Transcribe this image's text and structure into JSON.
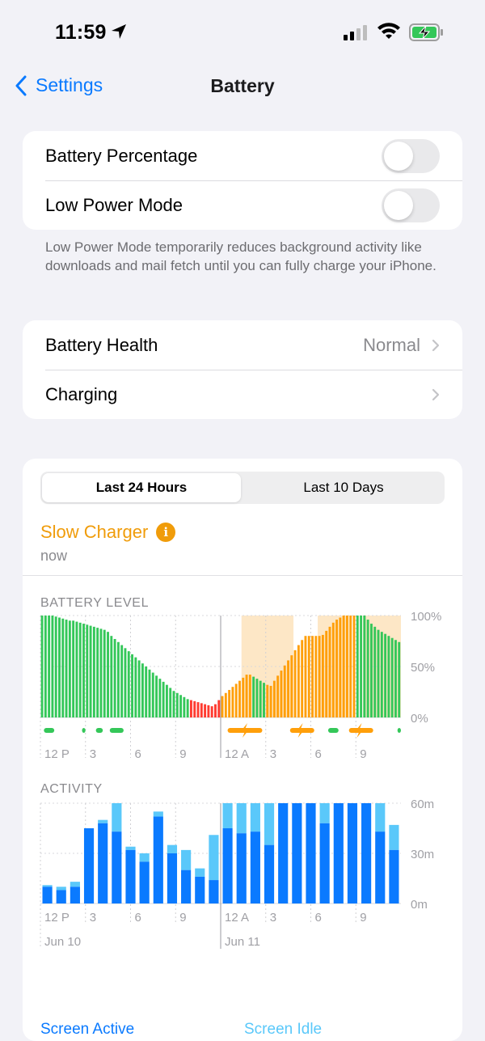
{
  "status": {
    "time": "11:59"
  },
  "nav": {
    "back_label": "Settings",
    "title": "Battery"
  },
  "settings_group1": {
    "battery_percentage": {
      "label": "Battery Percentage",
      "on": false
    },
    "low_power_mode": {
      "label": "Low Power Mode",
      "on": false
    },
    "footnote": "Low Power Mode temporarily reduces background activity like downloads and mail fetch until you can fully charge your iPhone."
  },
  "settings_group2": {
    "battery_health": {
      "label": "Battery Health",
      "value": "Normal"
    },
    "charging": {
      "label": "Charging"
    }
  },
  "usage": {
    "segments": [
      "Last 24 Hours",
      "Last 10 Days"
    ],
    "selected_segment": "Last 24 Hours",
    "charger_title": "Slow Charger",
    "charger_time": "now",
    "battery_label": "BATTERY LEVEL",
    "activity_label": "ACTIVITY",
    "legend_active": "Screen Active",
    "legend_idle": "Screen Idle"
  },
  "colors": {
    "accent": "#0a7aff",
    "battery_green": "#34c759",
    "battery_charging": "#ff9f0a",
    "battery_low": "#ff3b30",
    "active": "#0a7aff",
    "idle": "#5ac8fa",
    "charging_band": "#fde7c6"
  },
  "chart_data": [
    {
      "type": "bar",
      "title": "BATTERY LEVEL",
      "x_tick_labels": [
        "12 P",
        "3",
        "6",
        "9",
        "12 A",
        "3",
        "6",
        "9"
      ],
      "y_tick_labels": [
        "100%",
        "50%",
        "0%"
      ],
      "ylim": [
        0,
        100
      ],
      "values": [
        100,
        100,
        100,
        100,
        99,
        98,
        97,
        96,
        95,
        95,
        94,
        93,
        92,
        91,
        90,
        89,
        88,
        87,
        86,
        84,
        80,
        77,
        74,
        71,
        68,
        65,
        62,
        59,
        56,
        53,
        50,
        47,
        44,
        41,
        38,
        35,
        32,
        29,
        26,
        24,
        22,
        20,
        18,
        17,
        16,
        15,
        14,
        13,
        12,
        11,
        13,
        17,
        21,
        24,
        27,
        30,
        33,
        36,
        39,
        42,
        42,
        40,
        38,
        36,
        34,
        32,
        31,
        36,
        41,
        46,
        51,
        56,
        61,
        66,
        71,
        76,
        80,
        80,
        80,
        80,
        80,
        81,
        85,
        89,
        93,
        96,
        98,
        100,
        100,
        100,
        100,
        100,
        100,
        100,
        96,
        92,
        89,
        86,
        84,
        82,
        80,
        78,
        76,
        74
      ],
      "bar_states": "green before charging; red when low (~12-20%); orange while charging",
      "charging_periods_label": "charging"
    },
    {
      "type": "bar",
      "title": "ACTIVITY",
      "x_tick_labels": [
        "12 P",
        "3",
        "6",
        "9",
        "12 A",
        "3",
        "6",
        "9"
      ],
      "date_labels": [
        "Jun 10",
        "Jun 11"
      ],
      "y_tick_labels": [
        "60m",
        "30m",
        "0m"
      ],
      "ylim": [
        0,
        60
      ],
      "series": [
        {
          "name": "Screen Active",
          "values": [
            10,
            8,
            10,
            45,
            48,
            43,
            32,
            25,
            52,
            30,
            20,
            16,
            14,
            45,
            42,
            43,
            35,
            60,
            60,
            60,
            48,
            60,
            60,
            60,
            43,
            32
          ]
        },
        {
          "name": "Screen Idle",
          "values": [
            1,
            2,
            3,
            0,
            2,
            17,
            2,
            5,
            3,
            5,
            12,
            5,
            27,
            15,
            18,
            17,
            25,
            0,
            0,
            0,
            12,
            0,
            0,
            0,
            17,
            15
          ]
        }
      ]
    }
  ]
}
